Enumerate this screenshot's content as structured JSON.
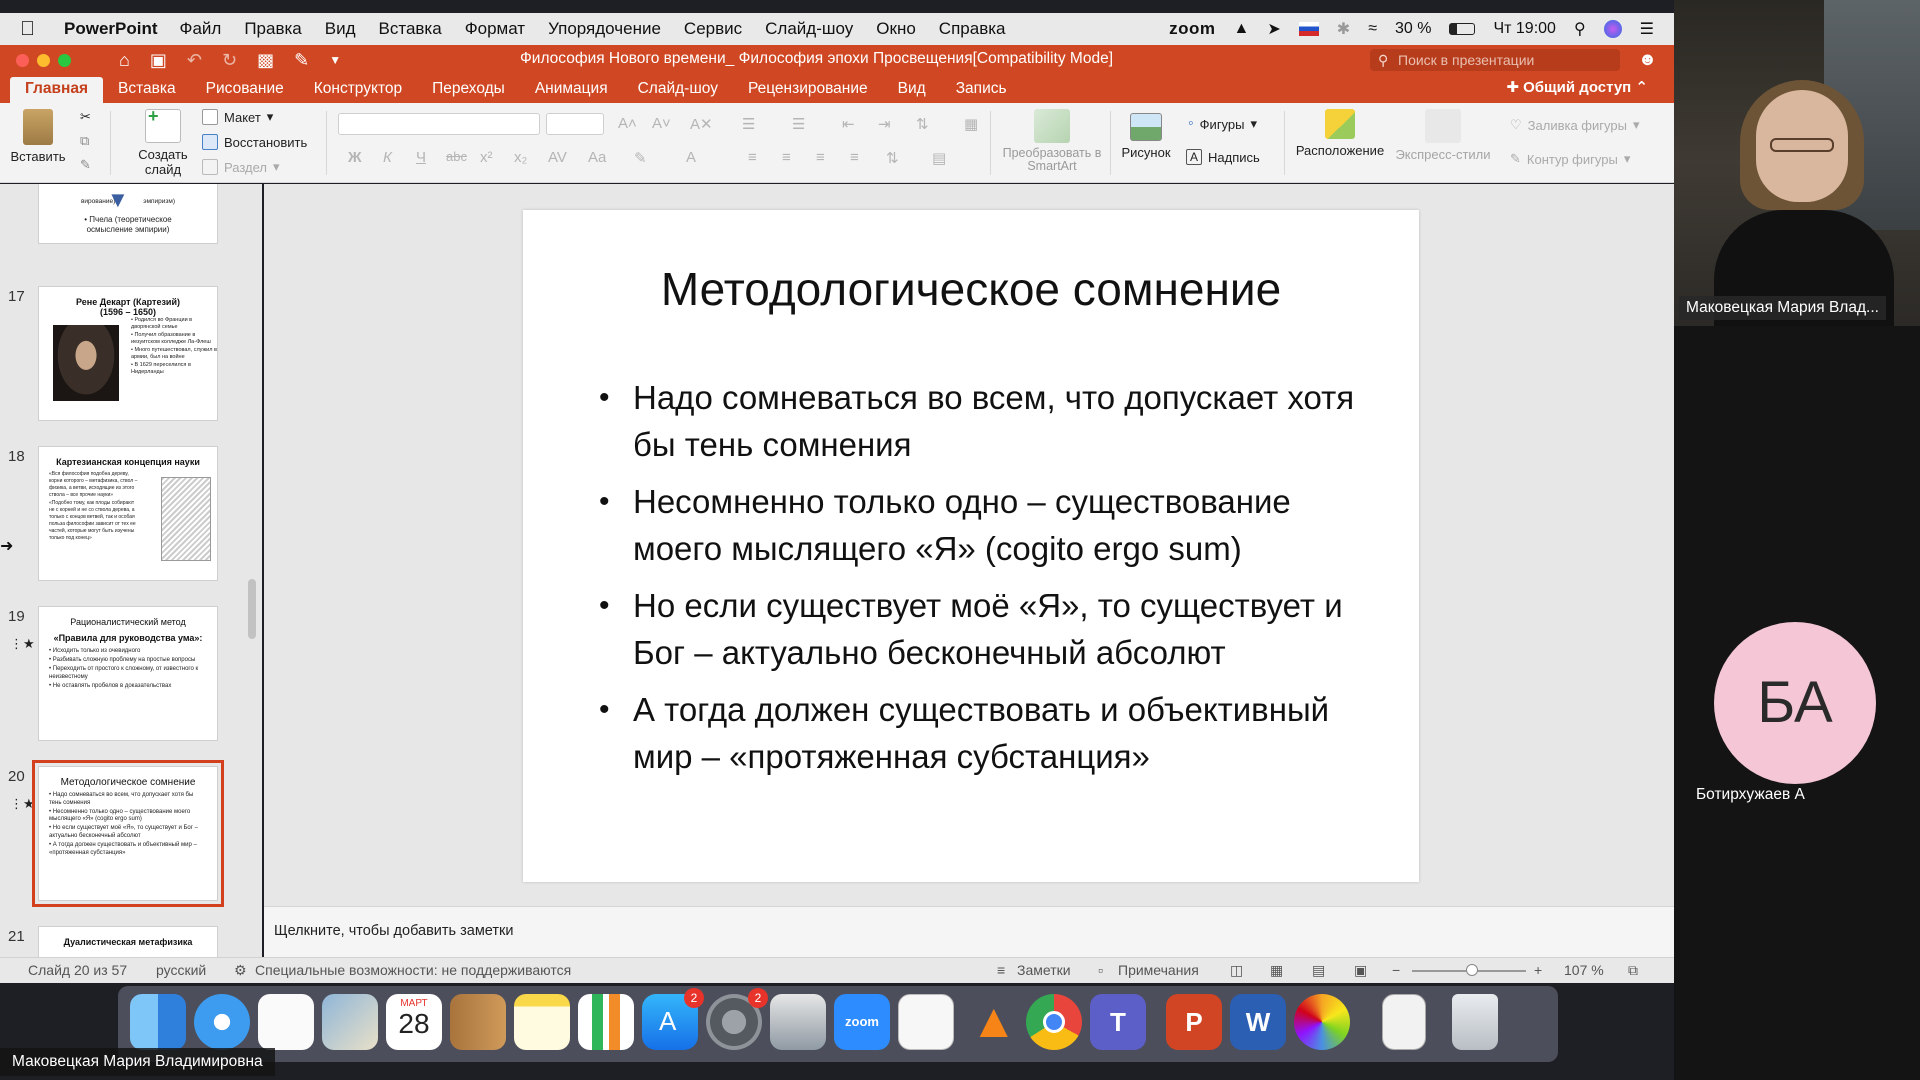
{
  "menubar": {
    "app": "PowerPoint",
    "items": [
      "Файл",
      "Правка",
      "Вид",
      "Вставка",
      "Формат",
      "Упорядочение",
      "Сервис",
      "Слайд-шоу",
      "Окно",
      "Справка"
    ],
    "zoom_label": "zoom",
    "battery": "30 %",
    "clock": "Чт 19:00"
  },
  "titlebar": {
    "doc_title": "Философия Нового времени_ Философия эпохи Просвещения[Compatibility Mode]",
    "search_placeholder": "Поиск в презентации"
  },
  "tabs": [
    "Главная",
    "Вставка",
    "Рисование",
    "Конструктор",
    "Переходы",
    "Анимация",
    "Слайд-шоу",
    "Рецензирование",
    "Вид",
    "Запись"
  ],
  "share_label": "Общий доступ",
  "ribbon": {
    "paste": "Вставить",
    "new_slide": "Создать слайд",
    "layout": "Макет",
    "reset": "Восстановить",
    "section": "Раздел",
    "smartart": "Преобразовать в SmartArt",
    "picture": "Рисунок",
    "shapes": "Фигуры",
    "textbox": "Надпись",
    "arrange": "Расположение",
    "quick_styles": "Экспресс-стили",
    "shape_fill": "Заливка фигуры",
    "shape_outline": "Контур фигуры"
  },
  "thumbnails": [
    {
      "num": "",
      "title": "",
      "lines": [
        "вирование)",
        "эмпиризм)",
        "• Пчела (теоретическое",
        "осмысление эмпирии)"
      ]
    },
    {
      "num": "17",
      "title": "Рене Декарт (Картезий) (1596 – 1650)",
      "lines": [
        "• Родился во Франции в дворянской семье",
        "• Получил образование в иезуитском колледже Ла-Флеш",
        "• Много путешествовал, служил в армии, был на войне",
        "• В 1629 переселился в Нидерланды"
      ]
    },
    {
      "num": "18",
      "title": "Картезианская концепция науки",
      "lines": [
        "«Вся философия подобна дереву, корни которого – метафизика, ствол – физика, а ветви, исходящие из этого ствола – все прочие науки»",
        "«Подобно тому, как плоды собирают не с корней и не со ствола дерева, а только с концов ветвей, так и особая польза философии зависит от тех ее частей, которые могут быть изучены только под конец»"
      ]
    },
    {
      "num": "19",
      "title": "Рационалистический метод",
      "subtitle": "«Правила для руководства ума»:",
      "lines": [
        "• Исходить только из очевидного",
        "• Разбивать сложную проблему на простые вопросы",
        "• Переходить от простого к сложному, от известного к неизвестному",
        "• Не оставлять пробелов в доказательствах"
      ]
    },
    {
      "num": "20",
      "title": "Методологическое сомнение",
      "lines": [
        "• Надо сомневаться во всем, что допускает хотя бы тень сомнения",
        "• Несомненно только одно – существование моего мыслящего «Я» (cogito ergo sum)",
        "• Но если существует моё «Я», то существует и Бог – актуально бесконечный абсолют",
        "• А тогда должен существовать и объективный мир – «протяженная субстанция»"
      ]
    },
    {
      "num": "21",
      "title": "Дуалистическая метафизика",
      "lines": []
    }
  ],
  "slide": {
    "title": "Методологическое сомнение",
    "bullets": [
      "Надо сомневаться во всем, что допускает хотя бы тень сомнения",
      "Несомненно только одно – существование моего мыслящего «Я» (cogito ergo sum)",
      "Но если существует моё «Я», то существует и Бог – актуально бесконечный абсолют",
      "А тогда должен существовать и объективный мир – «протяженная субстанция»"
    ]
  },
  "notes_placeholder": "Щелкните, чтобы добавить заметки",
  "status": {
    "slide_of": "Слайд 20 из 57",
    "language": "русский",
    "accessibility": "Специальные возможности: не поддерживаются",
    "notes": "Заметки",
    "comments": "Примечания",
    "zoom": "107 %"
  },
  "dock": {
    "calendar_month": "МАРТ",
    "calendar_day": "28",
    "appstore_badge": "2",
    "settings_badge": "2",
    "zoom_label": "zoom"
  },
  "presenter_name": "Маковецкая Мария Владимировна",
  "participants": {
    "video_label": "Маковецкая Мария Влад...",
    "avatar_initials": "БА",
    "avatar_name": "Ботирхужаев А"
  }
}
